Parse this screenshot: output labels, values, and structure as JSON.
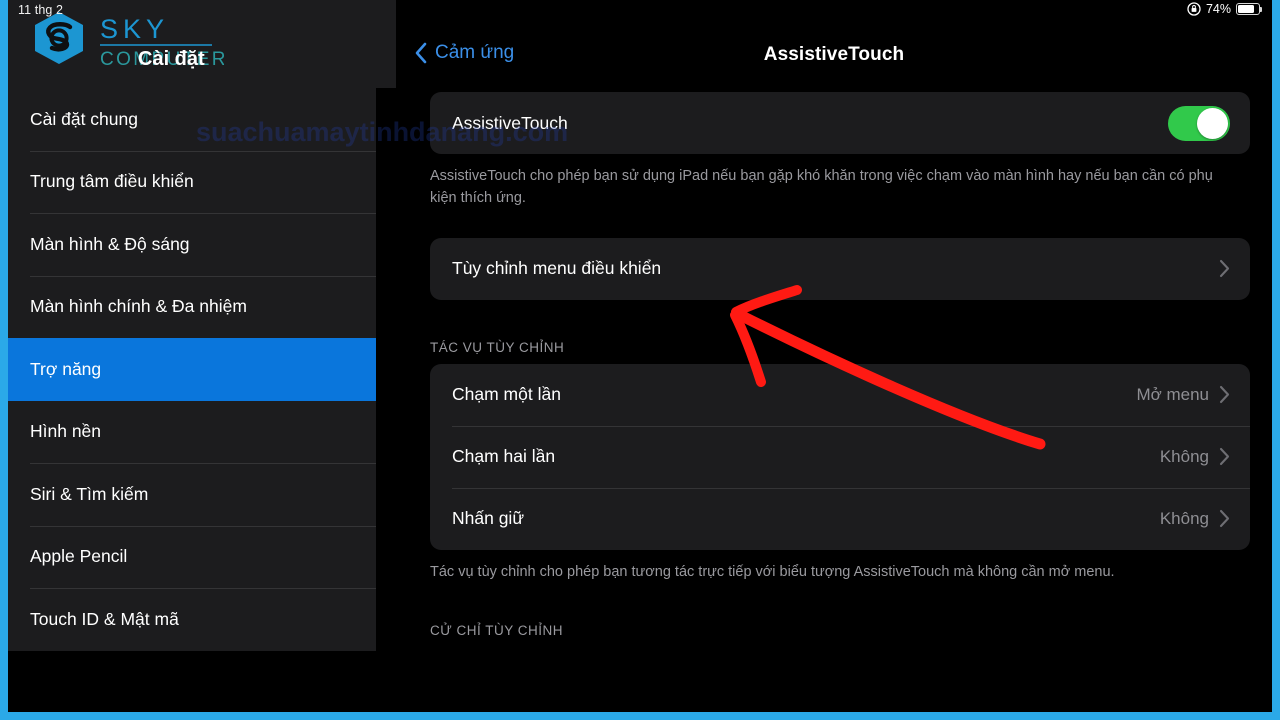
{
  "status_bar": {
    "date": "11 thg 2",
    "rotation_lock_icon": "rotation-lock-icon",
    "battery_percent": "74%",
    "battery_icon": "battery-icon"
  },
  "sidebar": {
    "title": "Cài đặt",
    "logo": {
      "mark_icon": "sky-hexagon-s-logo-icon",
      "name": "SKY",
      "subtitle": "COMPUTER",
      "brand_color": "#1DA1E2",
      "subtitle_color": "#2CA3A8"
    },
    "items": [
      {
        "label": "Cài đặt chung",
        "selected": false
      },
      {
        "label": "Trung tâm điều khiển",
        "selected": false
      },
      {
        "label": "Màn hình & Độ sáng",
        "selected": false
      },
      {
        "label": "Màn hình chính & Đa nhiệm",
        "selected": false
      },
      {
        "label": "Trợ năng",
        "selected": true
      },
      {
        "label": "Hình nền",
        "selected": false
      },
      {
        "label": "Siri & Tìm kiếm",
        "selected": false
      },
      {
        "label": "Apple Pencil",
        "selected": false
      },
      {
        "label": "Touch ID & Mật mã",
        "selected": false
      }
    ],
    "selection_color": "#0A76DC"
  },
  "detail": {
    "back_label": "Cảm ứng",
    "back_icon": "chevron-left-icon",
    "title": "AssistiveTouch",
    "toggle_row": {
      "label": "AssistiveTouch",
      "toggle_state": "on",
      "toggle_on_color": "#31C94B"
    },
    "toggle_footnote": "AssistiveTouch cho phép bạn sử dụng iPad nếu bạn gặp khó khăn trong việc chạm vào màn hình hay nếu bạn cần có phụ kiện thích ứng.",
    "customize_menu_row": {
      "label": "Tùy chỉnh menu điều khiển",
      "chevron_icon": "chevron-right-icon"
    },
    "custom_actions": {
      "header": "TÁC VỤ TÙY CHỈNH",
      "rows": [
        {
          "label": "Chạm một lần",
          "value": "Mở menu",
          "chevron_icon": "chevron-right-icon"
        },
        {
          "label": "Chạm hai lần",
          "value": "Không",
          "chevron_icon": "chevron-right-icon"
        },
        {
          "label": "Nhấn giữ",
          "value": "Không",
          "chevron_icon": "chevron-right-icon"
        }
      ],
      "footnote": "Tác vụ tùy chỉnh cho phép bạn tương tác trực tiếp với biểu tượng AssistiveTouch mà không cần mở menu."
    },
    "custom_gestures": {
      "header": "CỬ CHỈ TÙY CHỈNH"
    }
  },
  "watermarks": {
    "url": "suachuamaytinhdanang.com",
    "url_color": "#2440A8"
  },
  "annotation": {
    "arrow_color": "#FF1A13",
    "arrow_name": "red-pointer-arrow"
  }
}
